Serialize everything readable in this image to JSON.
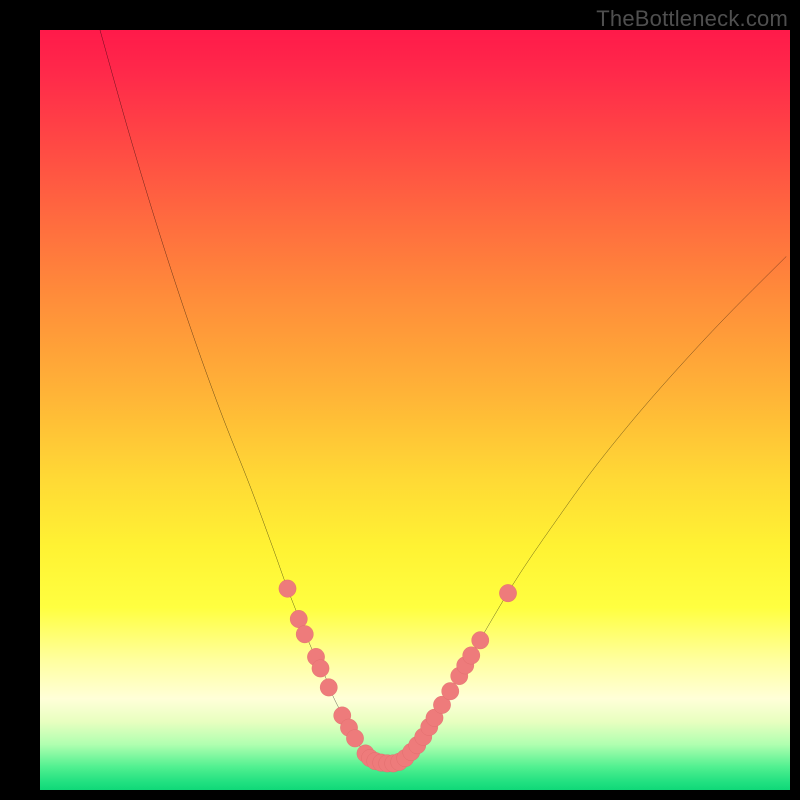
{
  "watermark": "TheBottleneck.com",
  "colors": {
    "background": "#000000",
    "line": "#000000",
    "dot_fill": "#ee7b7b",
    "dot_stroke": "#de6a6a",
    "gradient_top": "#ff1a4a",
    "gradient_mid": "#fff233",
    "gradient_bottom": "#20e080"
  },
  "chart_data": {
    "type": "line",
    "title": "",
    "xlabel": "",
    "ylabel": "",
    "xlim": [
      0,
      100
    ],
    "ylim": [
      0,
      100
    ],
    "note": "Values are read in plot-area percentage coordinates (0,0 = top-left of colored plot; 100,100 = bottom-right). No numeric axis ticks are rendered in source.",
    "series": [
      {
        "name": "bottleneck-curve",
        "x": [
          8,
          12,
          16,
          20,
          24,
          28,
          31,
          33,
          35,
          36.5,
          38,
          39,
          40,
          41,
          41.8,
          42.5,
          43.2,
          44,
          45,
          46,
          47,
          48,
          49,
          50.5,
          52,
          54,
          57,
          60,
          64,
          69,
          74,
          80,
          86,
          92,
          99.5
        ],
        "y": [
          0,
          14,
          27,
          39,
          50,
          60,
          68,
          73.5,
          78.5,
          82,
          85,
          87.5,
          89.5,
          91.3,
          92.8,
          94,
          95,
          95.8,
          96.3,
          96.5,
          96.5,
          96.3,
          95.5,
          93.8,
          91.5,
          88.2,
          83.2,
          78,
          71.5,
          64.3,
          57.5,
          50.2,
          43.5,
          37.2,
          29.8
        ]
      }
    ],
    "markers": {
      "name": "highlight-dots",
      "points": [
        {
          "x": 33.0,
          "y": 73.5
        },
        {
          "x": 34.5,
          "y": 77.5
        },
        {
          "x": 35.3,
          "y": 79.5
        },
        {
          "x": 36.8,
          "y": 82.5
        },
        {
          "x": 37.4,
          "y": 84.0
        },
        {
          "x": 38.5,
          "y": 86.5
        },
        {
          "x": 40.3,
          "y": 90.2
        },
        {
          "x": 41.2,
          "y": 91.8
        },
        {
          "x": 42.0,
          "y": 93.2
        },
        {
          "x": 43.4,
          "y": 95.2
        },
        {
          "x": 44.0,
          "y": 95.8
        },
        {
          "x": 44.7,
          "y": 96.2
        },
        {
          "x": 45.5,
          "y": 96.4
        },
        {
          "x": 46.3,
          "y": 96.5
        },
        {
          "x": 47.1,
          "y": 96.5
        },
        {
          "x": 47.9,
          "y": 96.3
        },
        {
          "x": 48.7,
          "y": 95.8
        },
        {
          "x": 49.5,
          "y": 95.0
        },
        {
          "x": 50.3,
          "y": 94.1
        },
        {
          "x": 51.1,
          "y": 93.0
        },
        {
          "x": 51.9,
          "y": 91.7
        },
        {
          "x": 52.6,
          "y": 90.5
        },
        {
          "x": 53.6,
          "y": 88.8
        },
        {
          "x": 54.7,
          "y": 87.0
        },
        {
          "x": 55.9,
          "y": 85.0
        },
        {
          "x": 56.7,
          "y": 83.6
        },
        {
          "x": 57.5,
          "y": 82.3
        },
        {
          "x": 58.7,
          "y": 80.3
        },
        {
          "x": 62.4,
          "y": 74.1
        }
      ]
    }
  }
}
